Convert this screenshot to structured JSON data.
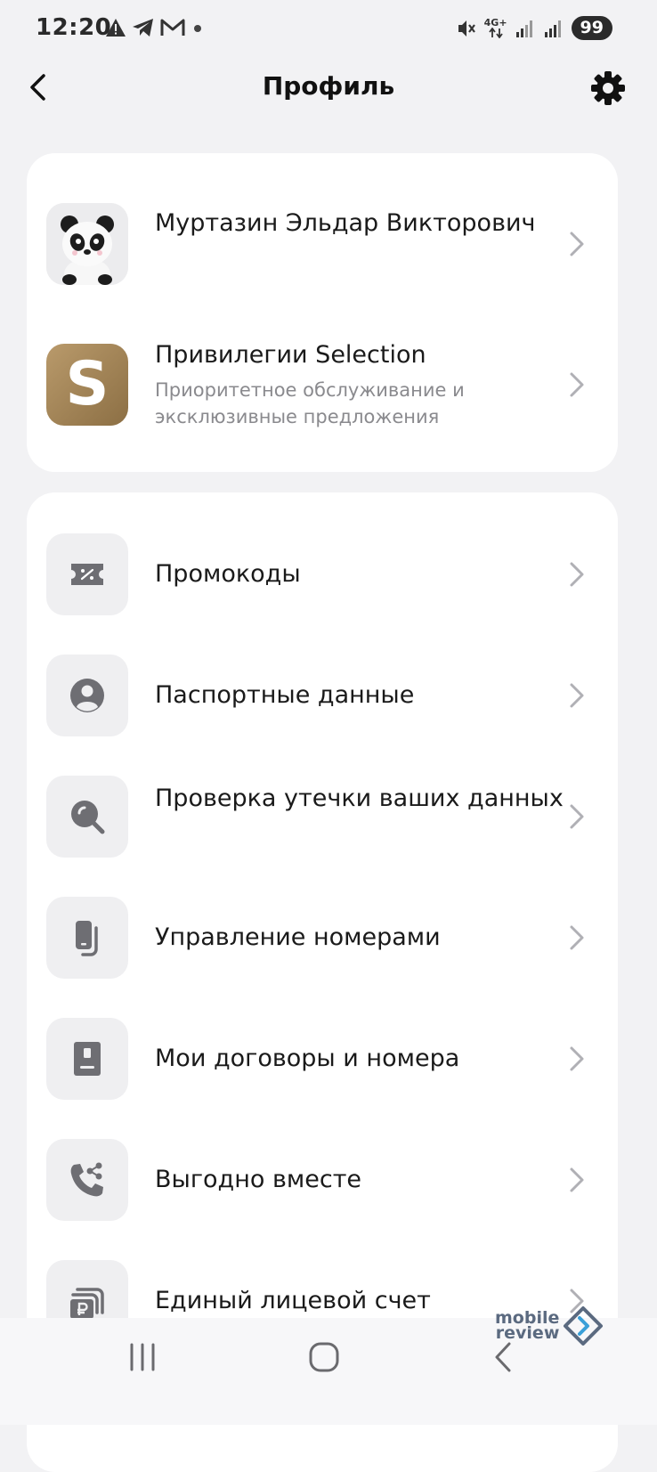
{
  "status_bar": {
    "time": "12:20",
    "network": "4G+",
    "battery": "99"
  },
  "header": {
    "title": "Профиль"
  },
  "profile": {
    "name": "Муртазин Эльдар Викторович"
  },
  "privileges": {
    "title": "Привилегии Selection",
    "subtitle": "Приоритетное обслуживание и эксклюзивные предложения",
    "badge_letter": "S"
  },
  "menu": {
    "items": [
      {
        "label": "Промокоды",
        "icon": "promo-ticket-icon"
      },
      {
        "label": "Паспортные данные",
        "icon": "person-icon"
      },
      {
        "label": "Проверка утечки ваших данных",
        "icon": "search-icon"
      },
      {
        "label": "Управление номерами",
        "icon": "phone-sim-icon"
      },
      {
        "label": "Мои договоры и номера",
        "icon": "contract-book-icon"
      },
      {
        "label": "Выгодно вместе",
        "icon": "phone-share-icon"
      },
      {
        "label": "Единый лицевой счет",
        "icon": "ruble-account-icon"
      }
    ]
  },
  "watermark": {
    "line1": "mobile",
    "line2": "review"
  },
  "colors": {
    "background": "#f2f2f4",
    "card": "#ffffff",
    "tile": "#efeff1",
    "icon": "#6e6e73",
    "chevron": "#b0b0b5",
    "subtitle": "#8a8a8e",
    "gold": "#a88b5e"
  }
}
